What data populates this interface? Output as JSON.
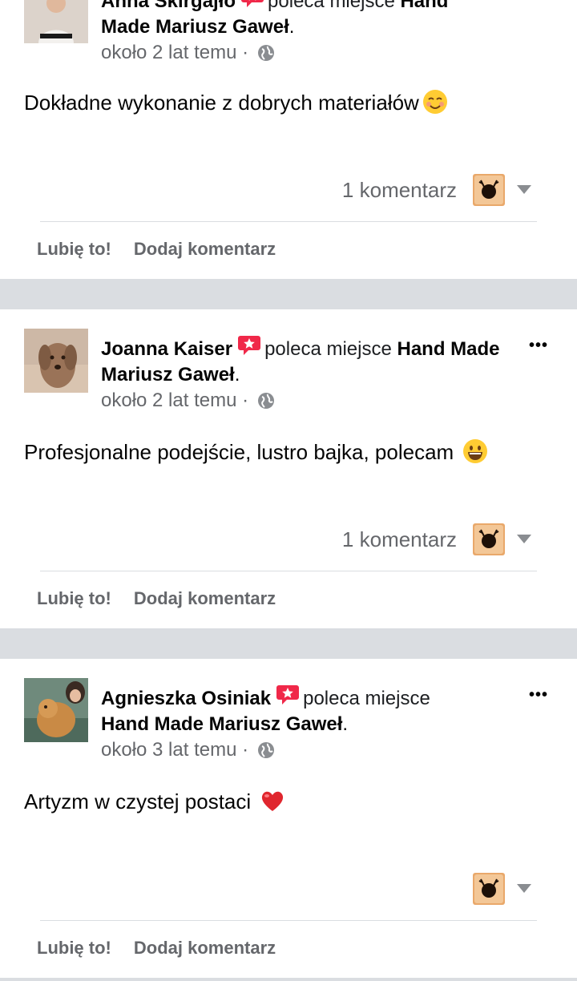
{
  "posts": [
    {
      "author": "Anna Skirgajło",
      "recommends": "poleca miejsce",
      "page": "Hand Made Mariusz Gaweł",
      "time": "około 2 lat temu",
      "separator": "·",
      "text": "Dokładne wykonanie z dobrych materiałów",
      "emoji": "smiling-blush-emoji",
      "comments": "1 komentarz",
      "like": "Lubię to!",
      "comment": "Dodaj komentarz"
    },
    {
      "author": "Joanna Kaiser",
      "recommends": "poleca miejsce",
      "page": "Hand Made Mariusz Gaweł",
      "time": "około 2 lat temu",
      "separator": "·",
      "text": "Profesjonalne podejście, lustro bajka, polecam",
      "emoji": "grinning-emoji",
      "comments": "1 komentarz",
      "like": "Lubię to!",
      "comment": "Dodaj komentarz"
    },
    {
      "author": "Agnieszka Osiniak",
      "recommends": "poleca miejsce",
      "page": "Hand Made Mariusz Gaweł",
      "time": "około 3 lat temu",
      "separator": "·",
      "text": "Artyzm w czystej postaci",
      "emoji": "red-heart-emoji",
      "comments": "",
      "like": "Lubię to!",
      "comment": "Dodaj komentarz"
    }
  ],
  "more_label": "•••",
  "colors": {
    "recommend_badge": "#f02849",
    "secondary_text": "#65676b",
    "separator_bg": "#dadde1"
  }
}
